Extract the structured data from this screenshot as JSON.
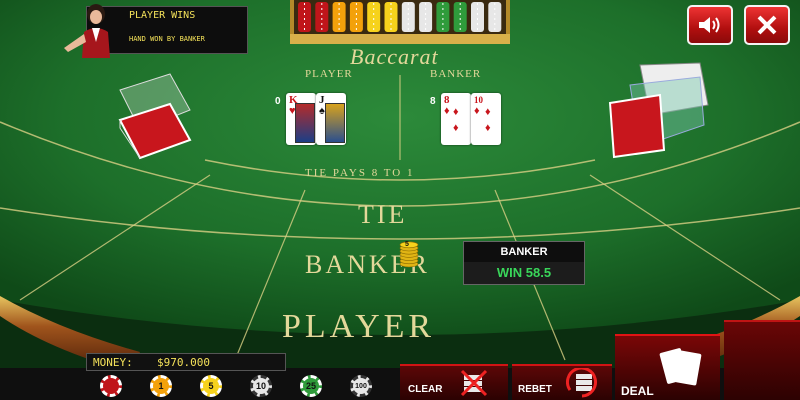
{
  "notification": {
    "title": "PLAYER WINS",
    "message": "HAND WON BY BANKER"
  },
  "table": {
    "game_name": "Baccarat",
    "player_label": "PLAYER",
    "banker_label": "BANKER",
    "tie_pays": "TIE PAYS 8 TO 1",
    "bet_tie": "TIE",
    "bet_banker": "BANKER",
    "bet_player": "PLAYER"
  },
  "hands": {
    "player_score": "0",
    "banker_score": "8",
    "player_cards": [
      {
        "rank": "K",
        "suit": "♥"
      },
      {
        "rank": "J",
        "suit": "♠"
      }
    ],
    "banker_cards": [
      {
        "rank": "8",
        "suit": "♦"
      },
      {
        "rank": "10",
        "suit": "♦"
      }
    ]
  },
  "bet_stack": {
    "chip_value": "5"
  },
  "result_box": {
    "title": "BANKER",
    "win_text": "WIN 58.5"
  },
  "money": {
    "label": "MONEY:",
    "value": "$970.000"
  },
  "chips": [
    {
      "value": "",
      "color": "#c0151a"
    },
    {
      "value": "1",
      "color": "#f3a10b"
    },
    {
      "value": "5",
      "color": "#f6d21c"
    },
    {
      "value": "10",
      "color": "#e7e7e7"
    },
    {
      "value": "25",
      "color": "#2f9b3b"
    },
    {
      "value": "100",
      "color": "#e7e7e7"
    }
  ],
  "buttons": {
    "clear": "CLEAR",
    "rebet": "REBET",
    "deal": "DEAL"
  },
  "icons": {
    "sound": "speaker-icon",
    "close": "close-icon"
  }
}
